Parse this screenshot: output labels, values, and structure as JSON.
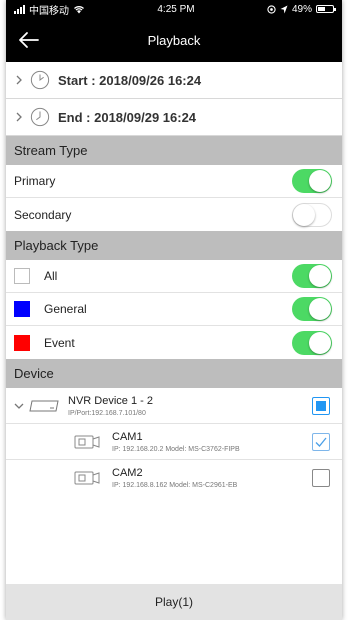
{
  "status_bar": {
    "carrier": "中国移动",
    "time": "4:25 PM",
    "battery": "49%",
    "battery_level": 0.49
  },
  "nav": {
    "title": "Playback"
  },
  "start": {
    "text": "Start : 2018/09/26 16:24"
  },
  "end": {
    "text": "End : 2018/09/29 16:24"
  },
  "stream_type": {
    "header": "Stream Type",
    "items": [
      {
        "label": "Primary",
        "on": true
      },
      {
        "label": "Secondary",
        "on": false
      }
    ]
  },
  "playback_type": {
    "header": "Playback Type",
    "items": [
      {
        "label": "All",
        "color": "#ffffff",
        "on": true
      },
      {
        "label": "General",
        "color": "#0000ff",
        "on": true
      },
      {
        "label": "Event",
        "color": "#ff0000",
        "on": true
      }
    ]
  },
  "device": {
    "header": "Device",
    "nvr": {
      "name": "NVR Device 1 - 2",
      "ip_port": "IP/Port:192.168.7.101/80",
      "check_state": "partial"
    },
    "cams": [
      {
        "name": "CAM1",
        "info": "IP: 192.168.20.2 Model: MS-C3762-FIPB",
        "checked": true
      },
      {
        "name": "CAM2",
        "info": "IP: 192.168.8.162 Model: MS-C2961-EB",
        "checked": false
      }
    ]
  },
  "footer": {
    "play_label": "Play(1)"
  },
  "colors": {
    "toggle_on": "#4cd964",
    "section_bg": "#bdbdbd",
    "checkbox_accent": "#2196f3"
  }
}
